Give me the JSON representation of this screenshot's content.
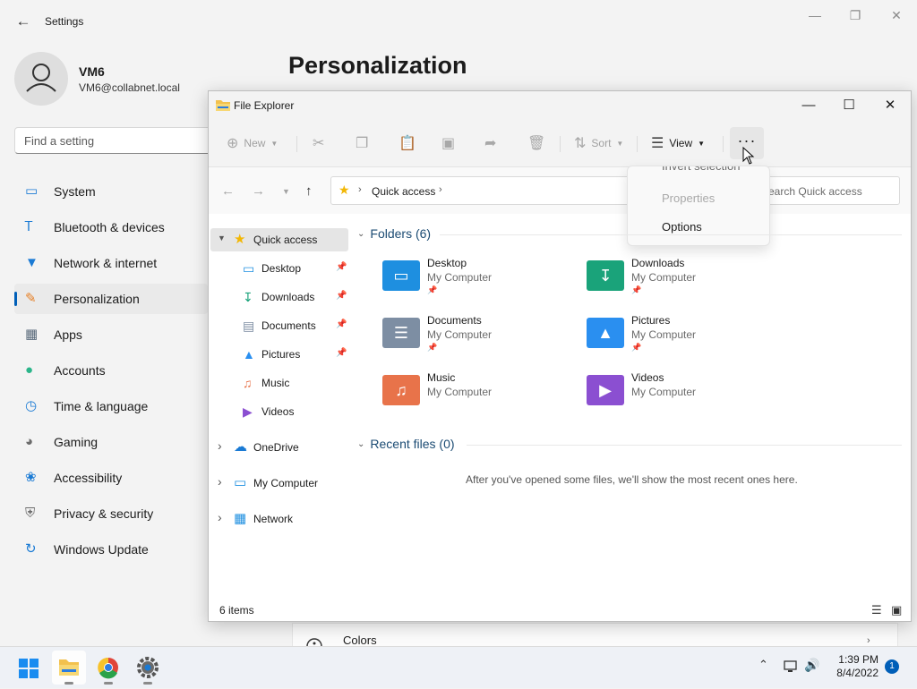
{
  "settings": {
    "title": "Settings",
    "user": {
      "name": "VM6",
      "email": "VM6@collabnet.local"
    },
    "search_placeholder": "Find a setting",
    "page_title": "Personalization",
    "nav": [
      {
        "label": "System",
        "icon": "monitor-icon",
        "color": "#1a7ad4"
      },
      {
        "label": "Bluetooth & devices",
        "icon": "bluetooth-icon",
        "color": "#1a7ad4"
      },
      {
        "label": "Network & internet",
        "icon": "wifi-icon",
        "color": "#1a7ad4"
      },
      {
        "label": "Personalization",
        "icon": "brush-icon",
        "color": "#e67e22"
      },
      {
        "label": "Apps",
        "icon": "apps-icon",
        "color": "#5b6b7c"
      },
      {
        "label": "Accounts",
        "icon": "person-icon",
        "color": "#2bb58a"
      },
      {
        "label": "Time & language",
        "icon": "clock-globe-icon",
        "color": "#1a7ad4"
      },
      {
        "label": "Gaming",
        "icon": "gamepad-icon",
        "color": "#6b6b6b"
      },
      {
        "label": "Accessibility",
        "icon": "accessibility-icon",
        "color": "#1a7ad4"
      },
      {
        "label": "Privacy & security",
        "icon": "shield-icon",
        "color": "#6b6b6b"
      },
      {
        "label": "Windows Update",
        "icon": "update-icon",
        "color": "#1a7ad4"
      }
    ],
    "selected_nav": "Personalization",
    "colors_row": "Colors"
  },
  "explorer": {
    "title": "File Explorer",
    "commands": {
      "new": "New",
      "sort": "Sort",
      "view": "View",
      "more": "···"
    },
    "address": {
      "location": "Quick access"
    },
    "search_placeholder": "Search Quick access",
    "dropdown": {
      "items": [
        "Invert selection",
        "Properties",
        "Options"
      ],
      "disabled": [
        false,
        true,
        false
      ]
    },
    "sidebar": {
      "quick_access": "Quick access",
      "pinned": [
        "Desktop",
        "Downloads",
        "Documents",
        "Pictures"
      ],
      "unpinned": [
        "Music",
        "Videos"
      ],
      "roots": [
        "OneDrive",
        "My Computer",
        "Network"
      ]
    },
    "folders_header": "Folders (6)",
    "folders": [
      {
        "name": "Desktop",
        "location": "My Computer",
        "pinned": true,
        "color": "#1e8fe0"
      },
      {
        "name": "Downloads",
        "location": "My Computer",
        "pinned": true,
        "color": "#1aa37a"
      },
      {
        "name": "Documents",
        "location": "My Computer",
        "pinned": true,
        "color": "#7d8ea3"
      },
      {
        "name": "Pictures",
        "location": "My Computer",
        "pinned": true,
        "color": "#2a8ff0"
      },
      {
        "name": "Music",
        "location": "My Computer",
        "pinned": false,
        "color": "#e8734a"
      },
      {
        "name": "Videos",
        "location": "My Computer",
        "pinned": false,
        "color": "#8b4fd1"
      }
    ],
    "recent_header": "Recent files (0)",
    "recent_empty": "After you've opened some files, we'll show the most recent ones here.",
    "status": "6 items"
  },
  "taskbar": {
    "time": "1:39 PM",
    "date": "8/4/2022",
    "notifications": "1"
  }
}
